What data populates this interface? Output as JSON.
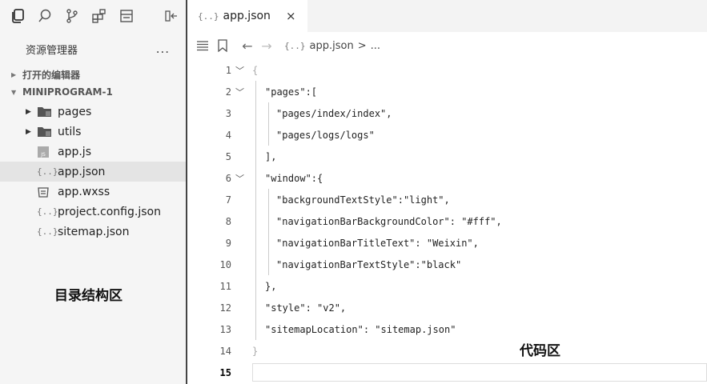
{
  "sidebar": {
    "toolbar_icons": [
      "copy-files-icon",
      "search-icon",
      "source-control-icon",
      "extensions-icon",
      "layout-icon",
      "collapse-panel-icon"
    ],
    "title": "资源管理器",
    "more": "...",
    "sections": {
      "open_editors": "打开的编辑器",
      "project": "MINIPROGRAM-1"
    },
    "tree": [
      {
        "label": "pages",
        "icon": "folder-icon"
      },
      {
        "label": "utils",
        "icon": "folder-icon"
      },
      {
        "label": "app.js",
        "icon": "js-file-icon"
      },
      {
        "label": "app.json",
        "icon": "json-file-icon"
      },
      {
        "label": "app.wxss",
        "icon": "wxss-file-icon"
      },
      {
        "label": "project.config.json",
        "icon": "json-file-icon"
      },
      {
        "label": "sitemap.json",
        "icon": "json-file-icon"
      }
    ],
    "annotation": "目录结构区"
  },
  "editor": {
    "tab": {
      "label": "app.json",
      "close": "×"
    },
    "breadcrumb": {
      "file": "app.json",
      "trail": ">",
      "more": "..."
    },
    "json_glyph": "{..}",
    "lines": [
      {
        "n": "1",
        "text": "{"
      },
      {
        "n": "2",
        "text": "\"pages\":["
      },
      {
        "n": "3",
        "text": "\"pages/index/index\","
      },
      {
        "n": "4",
        "text": "\"pages/logs/logs\""
      },
      {
        "n": "5",
        "text": "],"
      },
      {
        "n": "6",
        "text": "\"window\":{"
      },
      {
        "n": "7",
        "text": "\"backgroundTextStyle\":\"light\","
      },
      {
        "n": "8",
        "text": "\"navigationBarBackgroundColor\": \"#fff\","
      },
      {
        "n": "9",
        "text": "\"navigationBarTitleText\": \"Weixin\","
      },
      {
        "n": "10",
        "text": "\"navigationBarTextStyle\":\"black\""
      },
      {
        "n": "11",
        "text": "},"
      },
      {
        "n": "12",
        "text": "\"style\": \"v2\","
      },
      {
        "n": "13",
        "text": "\"sitemapLocation\": \"sitemap.json\""
      },
      {
        "n": "14",
        "text": "}"
      },
      {
        "n": "15",
        "text": ""
      }
    ],
    "annotation": "代码区"
  },
  "colors": {
    "sidebar_bg": "#f5f5f5",
    "selected_row": "#e4e4e4",
    "tabbar_bg": "#f3f3f3"
  }
}
